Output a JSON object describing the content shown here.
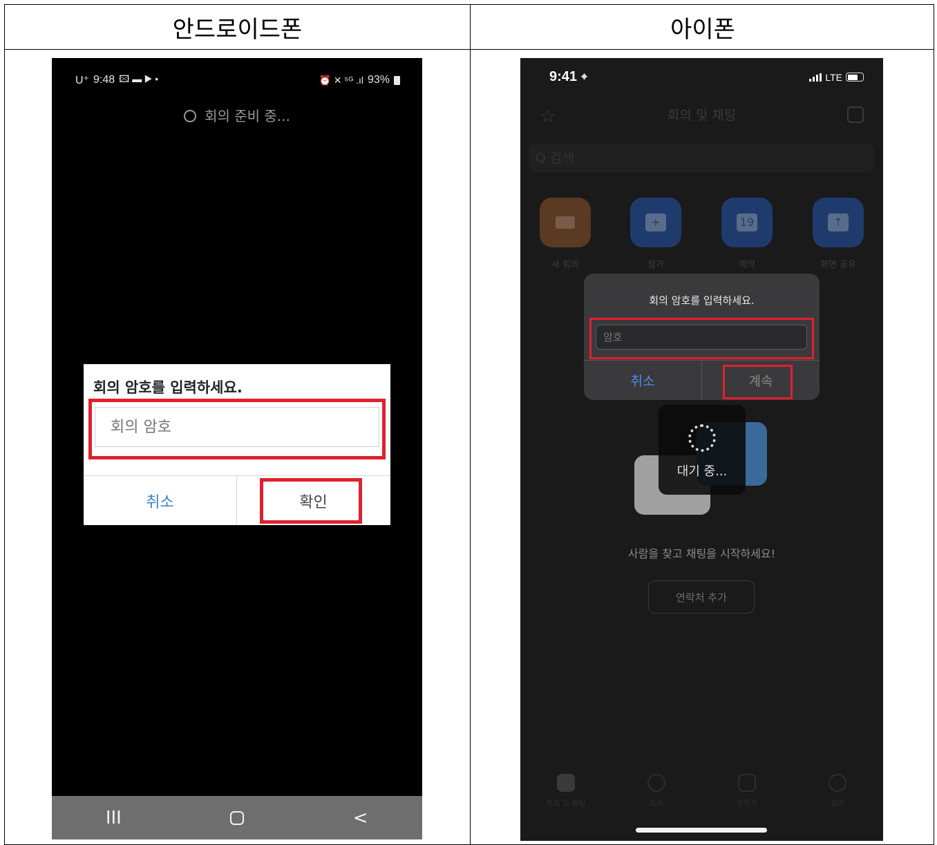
{
  "table": {
    "header_android": "안드로이드폰",
    "header_iphone": "아이폰"
  },
  "android": {
    "status": {
      "carrier": "U⁺",
      "time": "9:48",
      "left_icons": "🖾 ▬ ▶ •",
      "right_icons": "⏰ ✕ ⁵ᴳ .ıl",
      "battery": "93%"
    },
    "preparing_text": "회의 준비 중...",
    "dialog": {
      "title": "회의 암호를 입력하세요.",
      "password_placeholder": "회의 암호",
      "password_value": "",
      "cancel_label": "취소",
      "confirm_label": "확인"
    },
    "nav": {
      "recents": "III",
      "back": "<"
    }
  },
  "iphone": {
    "status": {
      "time": "9:41",
      "location_icon": "⌖",
      "network": "LTE"
    },
    "header_title": "회의 및 채팅",
    "search_placeholder": "Q 검색",
    "actions": [
      {
        "label": "새 회의"
      },
      {
        "label": "참가",
        "symbol": "+"
      },
      {
        "label": "예약",
        "symbol": "19"
      },
      {
        "label": "화면 공유",
        "symbol": "↑"
      }
    ],
    "dialog": {
      "title": "회의 암호를 입력하세요.",
      "password_placeholder": "암호",
      "password_value": "",
      "cancel_label": "취소",
      "continue_label": "계속"
    },
    "waiting_text": "대기 중...",
    "prompt_text": "사람을 찾고 채팅을 시작하세요!",
    "add_contact_label": "연락처 추가",
    "tabs": [
      {
        "label": "회의 및 채팅"
      },
      {
        "label": "회의"
      },
      {
        "label": "연락처"
      },
      {
        "label": "설정"
      }
    ]
  },
  "colors": {
    "highlight_red": "#e0202e",
    "android_cancel_blue": "#3a7fd0",
    "ios_cancel_blue": "#4a8ff0"
  }
}
